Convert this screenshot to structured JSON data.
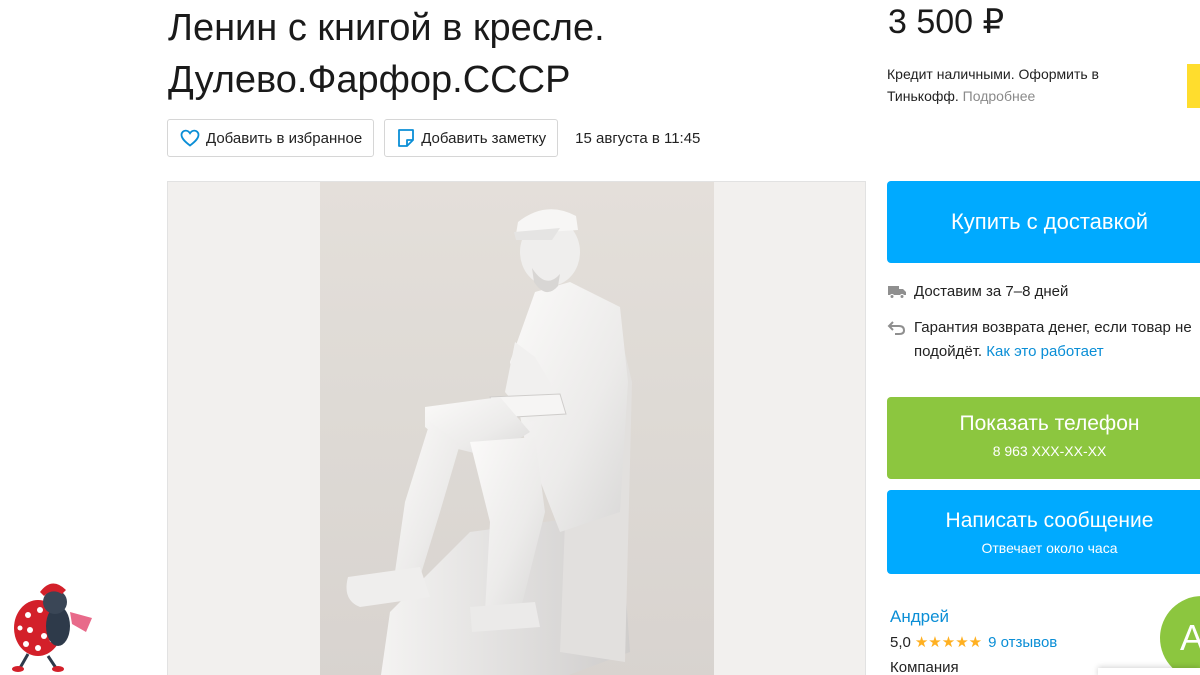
{
  "listing": {
    "title_line1": "Ленин с книгой в кресле.",
    "title_line2": "Дулево.Фарфор.СССР",
    "favorite_label": "Добавить в избранное",
    "note_label": "Добавить заметку",
    "date": "15 августа в 11:45"
  },
  "sidebar": {
    "price": "3 500 ₽",
    "credit_text": "Кредит наличными. Оформить в Тинькофф.",
    "credit_more": "Подробнее",
    "buy_label": "Купить с доставкой",
    "delivery_text": "Доставим за 7–8 дней",
    "guarantee_text": "Гарантия возврата денег, если товар не подойдёт.",
    "guarantee_link": "Как это работает",
    "phone_label": "Показать телефон",
    "phone_number": "8 963 XXX-XX-XX",
    "message_label": "Написать сообщение",
    "message_sub": "Отвечает около часа",
    "seller_name": "Андрей",
    "rating": "5,0",
    "stars": "★★★★★",
    "reviews": "9 отзывов",
    "seller_type": "Компания",
    "avatar_letter": "А"
  },
  "colors": {
    "accent_blue": "#00aaff",
    "accent_green": "#8cc63f",
    "link": "#0a8ed6",
    "star": "#ffb021"
  },
  "icons": [
    "heart-icon",
    "note-icon",
    "truck-icon",
    "return-arrow-icon"
  ]
}
